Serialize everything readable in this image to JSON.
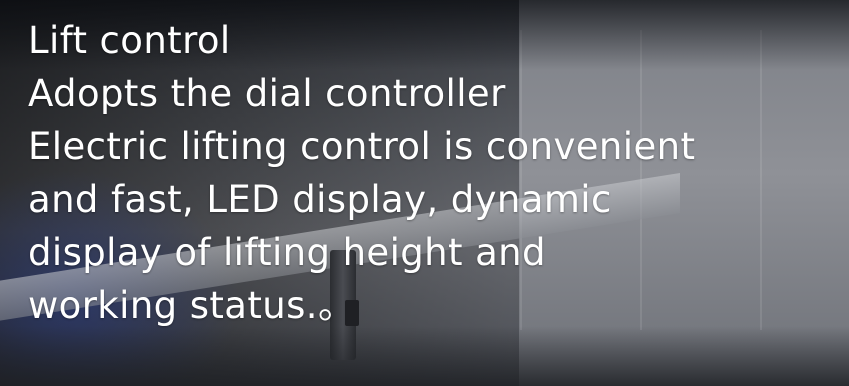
{
  "caption": {
    "lines": [
      "Lift control",
      "Adopts the dial controller",
      "Electric lifting control is convenient",
      "and fast, LED display, dynamic",
      "display of lifting height and",
      "working status.。"
    ]
  }
}
